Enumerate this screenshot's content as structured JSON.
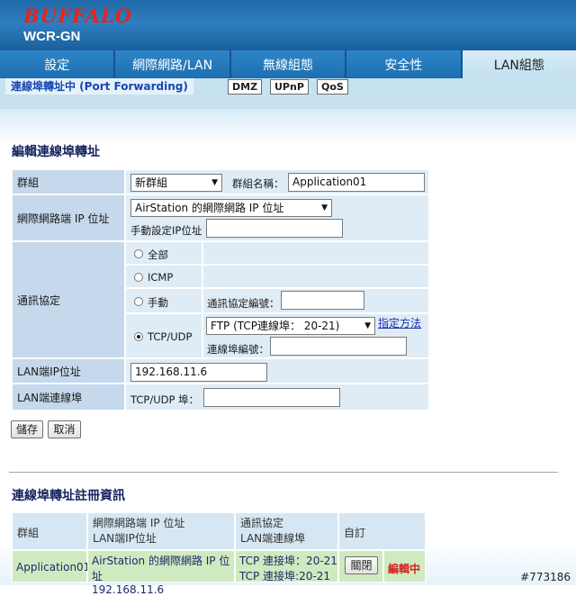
{
  "header": {
    "brand": "BUFFALO",
    "model": "WCR-GN"
  },
  "tabs": [
    {
      "label": "設定",
      "active": false
    },
    {
      "label": "網際網路/LAN",
      "active": false
    },
    {
      "label": "無線組態",
      "active": false
    },
    {
      "label": "安全性",
      "active": false
    },
    {
      "label": "LAN組態",
      "active": true
    }
  ],
  "subnav": {
    "current": "連線埠轉址中 (Port Forwarding)",
    "links": [
      "DMZ",
      "UPnP",
      "QoS"
    ]
  },
  "edit": {
    "title": "編輯連線埠轉址",
    "group_label": "群組",
    "group_select": "新群組",
    "group_name_label": "群組名稱：",
    "group_name_value": "Application01",
    "wan_ip_label": "網際網路端 IP 位址",
    "wan_ip_select": "AirStation 的網際網路 IP 位址",
    "manual_ip_label": "手動設定IP位址",
    "manual_ip_value": "",
    "protocol_label": "通訊協定",
    "proto_all": "全部",
    "proto_icmp": "ICMP",
    "proto_manual": "手動",
    "proto_number_label": "通訊協定編號：",
    "proto_number_value": "",
    "proto_tcpudp": "TCP/UDP",
    "tcpudp_select": "FTP (TCP連線埠： 20-21)",
    "specify_method": "指定方法",
    "port_number_label": "連線埠編號：",
    "port_number_value": "",
    "lan_ip_label": "LAN端IP位址",
    "lan_ip_value": "192.168.11.6",
    "lan_port_label": "LAN端連線埠",
    "lan_port_sublabel": "TCP/UDP 埠：",
    "lan_port_value": "",
    "save": "儲存",
    "cancel": "取消"
  },
  "registry": {
    "title": "連線埠轉址註冊資訊",
    "headers": {
      "group": "群組",
      "wan_ip": "網際網路端 IP 位址",
      "lan_ip": "LAN端IP位址",
      "protocol": "通訊協定",
      "lan_port": "LAN端連線埠",
      "custom": "自訂"
    },
    "row": {
      "group": "Application01",
      "wan_ip": "AirStation 的網際網路 IP 位址",
      "lan_ip": "192.168.11.6",
      "protocol": "TCP 連接埠：20-21",
      "lan_port": "TCP 連接埠:20-21",
      "action": "關閉",
      "status": "編輯中"
    }
  },
  "watermark": "#773186",
  "colors": {
    "accent": "#2e7fc0",
    "brand_red": "#e8231b",
    "status_red": "#d0201a"
  }
}
